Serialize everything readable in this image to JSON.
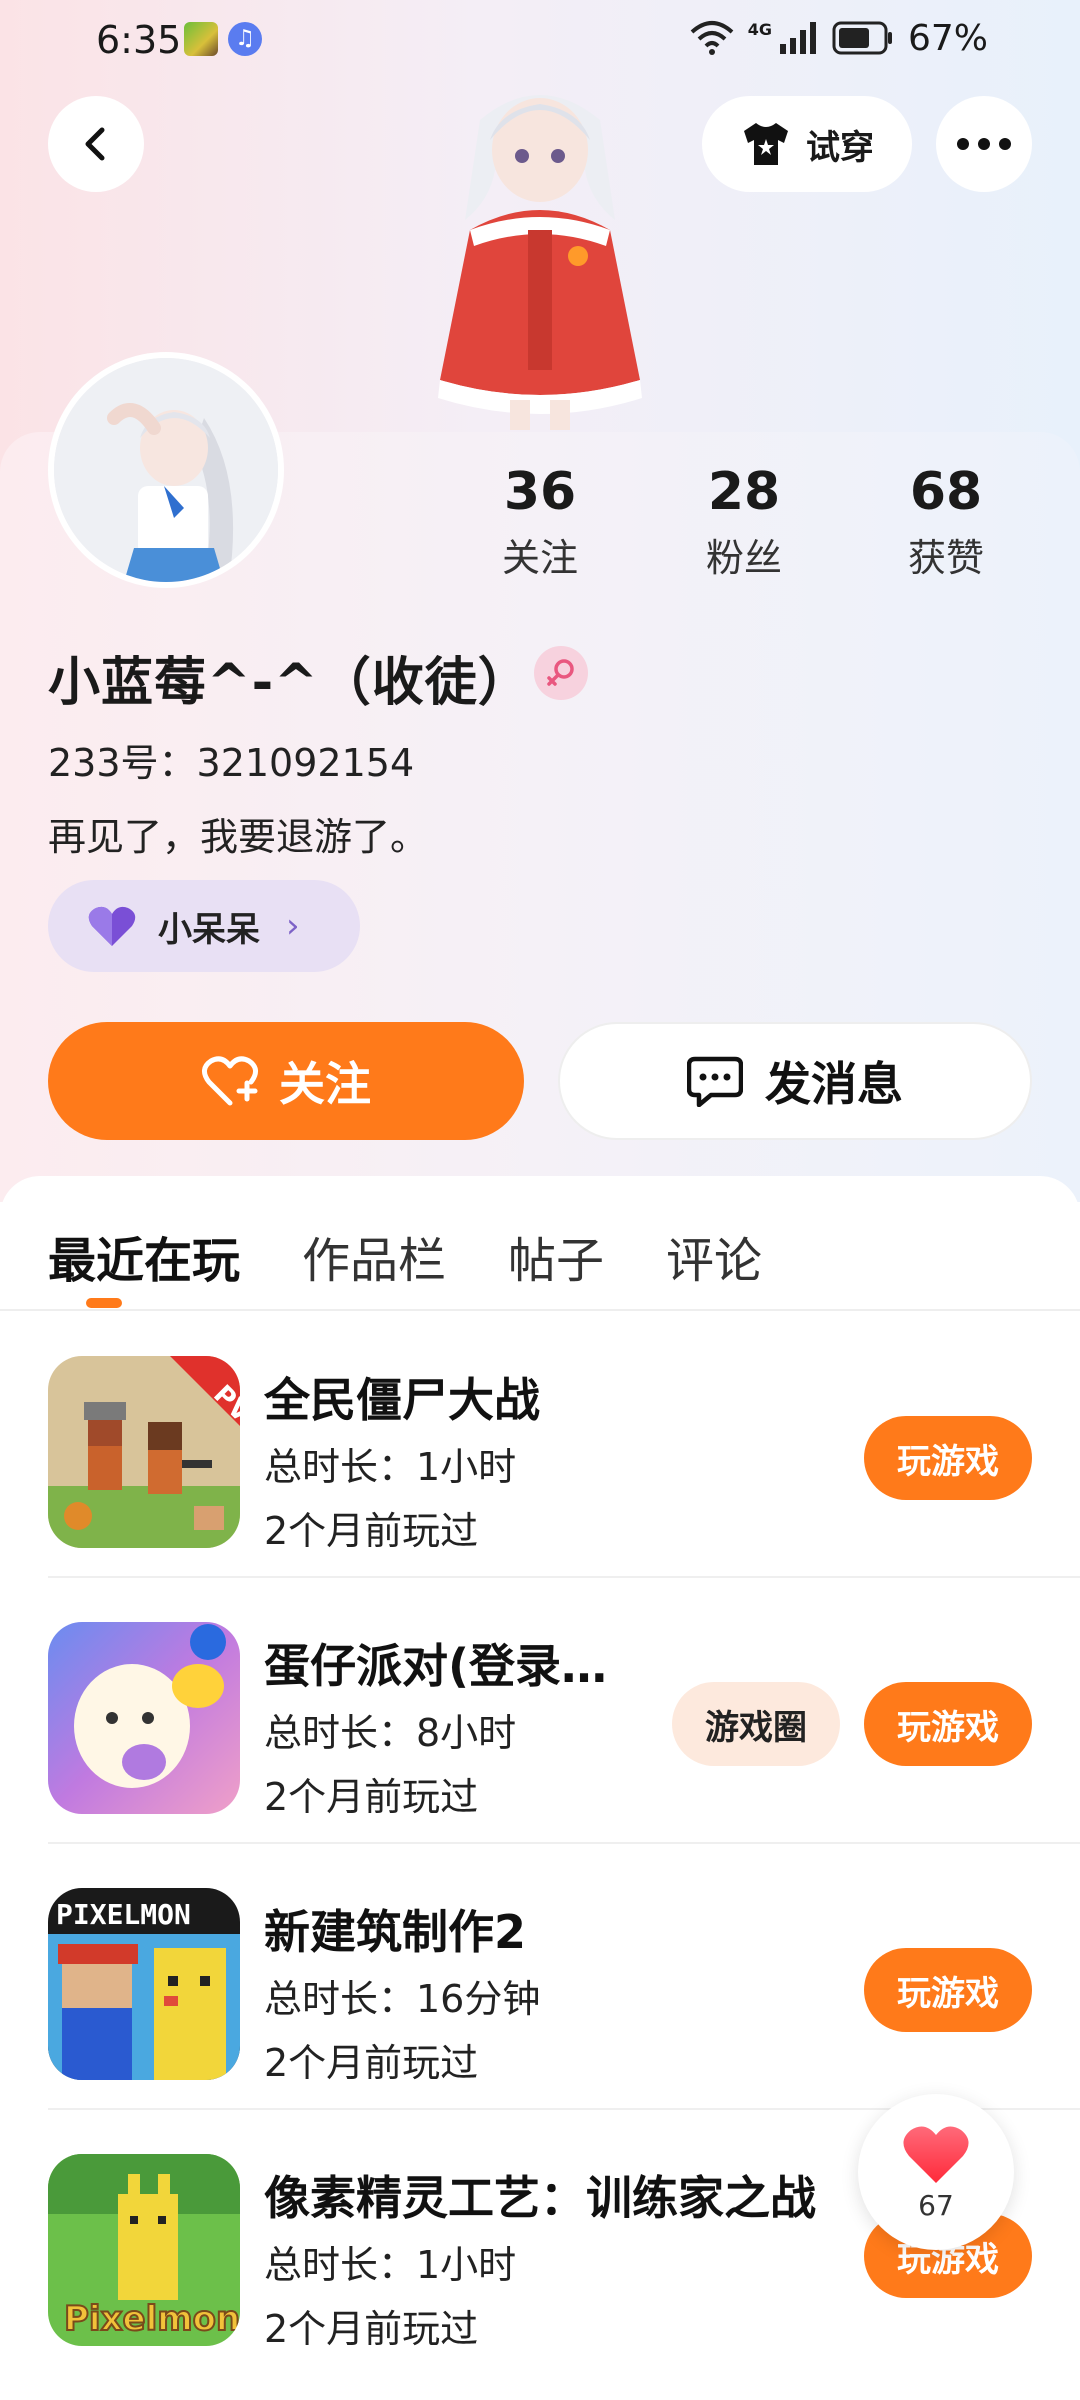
{
  "status_bar": {
    "time": "6:35",
    "battery": "67%",
    "network": "4G"
  },
  "header": {
    "try_on_label": "试穿"
  },
  "profile": {
    "stats": [
      {
        "value": "36",
        "label": "关注"
      },
      {
        "value": "28",
        "label": "粉丝"
      },
      {
        "value": "68",
        "label": "获赞"
      }
    ],
    "username": "小蓝莓^-^（收徒）",
    "gender": "female",
    "user_id": "233号：321092154",
    "bio": "再见了，我要退游了。",
    "guild": "小呆呆"
  },
  "actions": {
    "follow_label": "关注",
    "message_label": "发消息"
  },
  "tabs": [
    {
      "label": "最近在玩",
      "active": true
    },
    {
      "label": "作品栏",
      "active": false
    },
    {
      "label": "帖子",
      "active": false
    },
    {
      "label": "评论",
      "active": false
    }
  ],
  "games": [
    {
      "name": "全民僵尸大战",
      "duration": "总时长：1小时",
      "last_played": "2个月前玩过",
      "play_label": "玩游戏",
      "circle_label": "",
      "icon": "pvp-soldiers-game-icon"
    },
    {
      "name": "蛋仔派对(登录…",
      "duration": "总时长：8小时",
      "last_played": "2个月前玩过",
      "play_label": "玩游戏",
      "circle_label": "游戏圈",
      "icon": "eggy-party-game-icon"
    },
    {
      "name": "新建筑制作2",
      "duration": "总时长：16分钟",
      "last_played": "2个月前玩过",
      "play_label": "玩游戏",
      "circle_label": "",
      "icon": "pixelmon-game-icon"
    },
    {
      "name": "像素精灵工艺：训练家之战",
      "duration": "总时长：1小时",
      "last_played": "2个月前玩过",
      "play_label": "玩游戏",
      "circle_label": "",
      "icon": "pixelmon-online-game-icon"
    }
  ],
  "like_float": {
    "count": "67"
  },
  "colors": {
    "accent": "#ff7a1a",
    "guild_chip": "#e8e0f4",
    "gender_badge": "#f7d2de"
  }
}
